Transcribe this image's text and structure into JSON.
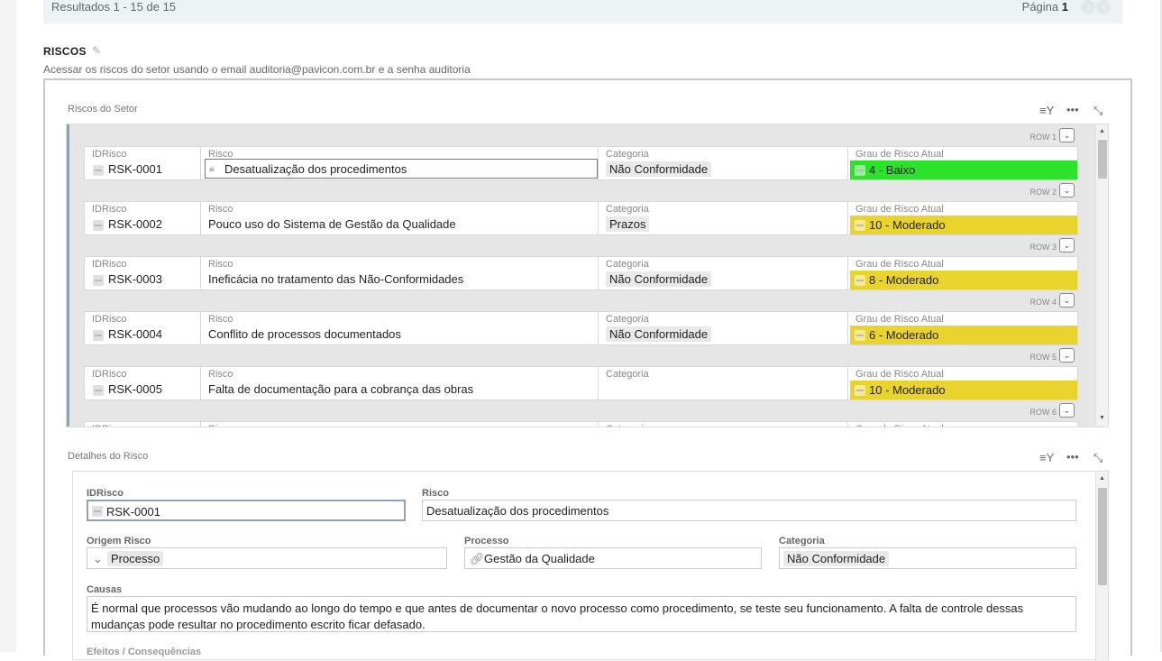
{
  "results": {
    "range_text": "Resultados 1 - 15 de 15",
    "page_label": "Página",
    "page_number": "1"
  },
  "section": {
    "title": "RISCOS",
    "description": "Acessar os riscos do setor usando o email auditoria@pavicon.com.br e a senha auditoria"
  },
  "grid_panel": {
    "title": "Riscos do Setor"
  },
  "grid": {
    "columns": {
      "id": "IDRisco",
      "risk": "Risco",
      "category": "Categoria",
      "grade": "Grau de Risco Atual"
    },
    "rows": [
      {
        "label": "ROW 1",
        "id": "RSK-0001",
        "risk": "Desatualização dos procedimentos",
        "category": "Não Conformidade",
        "grade": "4 - Baixo",
        "color": "#2be32b"
      },
      {
        "label": "ROW 2",
        "id": "RSK-0002",
        "risk": "Pouco uso do Sistema de Gestão da Qualidade",
        "category": "Prazos",
        "grade": "10 - Moderado",
        "color": "#e9d42e"
      },
      {
        "label": "ROW 3",
        "id": "RSK-0003",
        "risk": "Ineficácia no tratamento das Não-Conformidades",
        "category": "Não Conformidade",
        "grade": "8 - Moderado",
        "color": "#e9d42e"
      },
      {
        "label": "ROW 4",
        "id": "RSK-0004",
        "risk": "Conflito de processos documentados",
        "category": "Não Conformidade",
        "grade": "6 - Moderado",
        "color": "#e9d42e"
      },
      {
        "label": "ROW 5",
        "id": "RSK-0005",
        "risk": "Falta de documentação para a cobrança das obras",
        "category": "",
        "grade": "10 - Moderado",
        "color": "#e9d42e"
      },
      {
        "label": "ROW 6",
        "id": "",
        "risk": "",
        "category": "",
        "grade": "",
        "color": "#ffffff"
      }
    ]
  },
  "details_panel": {
    "title": "Detalhes do Risco"
  },
  "details": {
    "id_label": "IDRisco",
    "id_value": "RSK-0001",
    "risk_label": "Risco",
    "risk_value": "Desatualização dos procedimentos",
    "origin_label": "Origem Risco",
    "origin_value": "Processo",
    "process_label": "Processo",
    "process_value": "Gestão da Qualidade",
    "category_label": "Categoria",
    "category_value": "Não Conformidade",
    "causes_label": "Causas",
    "causes_value": "É normal que processos vão mudando ao longo do tempo e que antes de documentar o novo processo como procedimento, se teste seu funcionamento. A falta de controle dessas mudanças pode resultar no procedimento escrito ficar defasado.",
    "effects_label": "Efeitos / Consequências"
  },
  "icons": [
    "pencil-icon",
    "filter-icon",
    "more-icon",
    "expand-icon",
    "chevron-down-icon",
    "lock-icon",
    "link-icon",
    "document-icon"
  ]
}
